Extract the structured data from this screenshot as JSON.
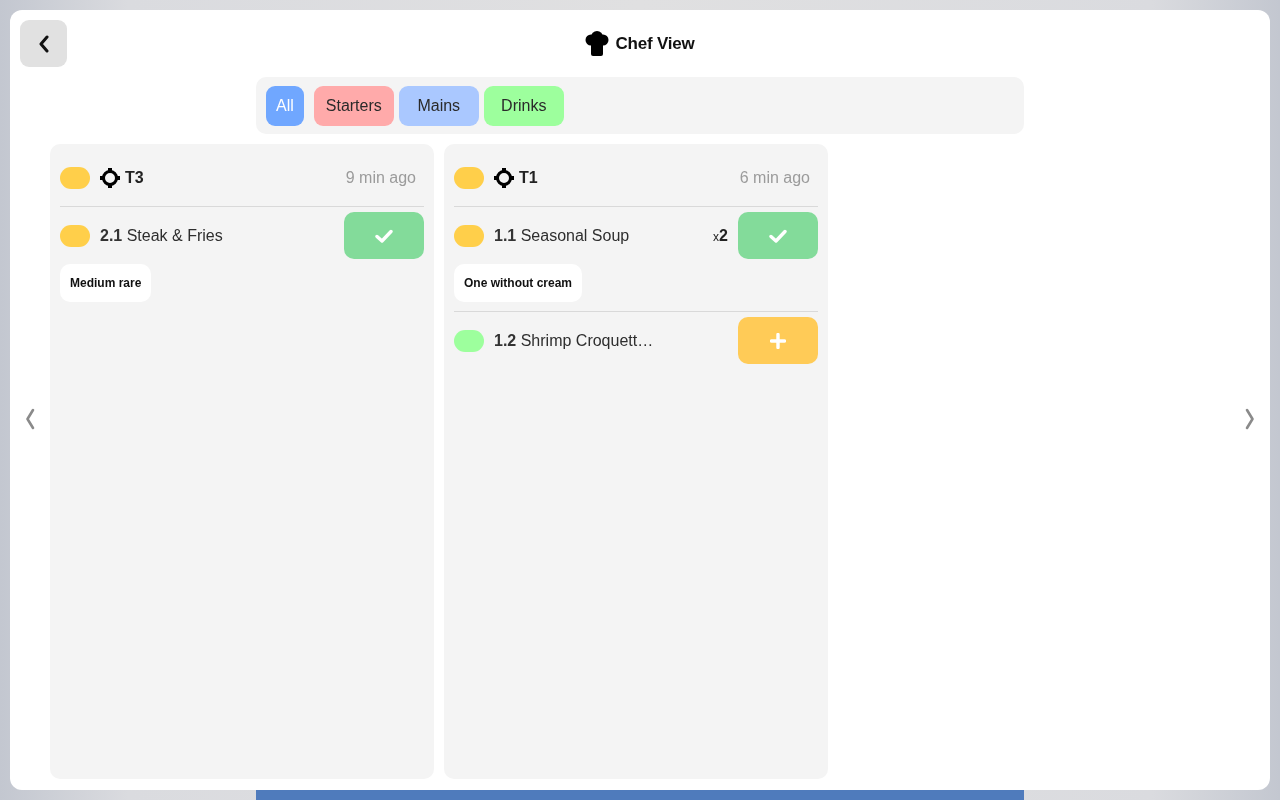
{
  "header": {
    "title": "Chef View"
  },
  "filters": [
    {
      "label": "All",
      "kind": "all",
      "selected": true,
      "color": "#70a7ff"
    },
    {
      "label": "Starters",
      "kind": "category",
      "selected": false,
      "color": "#ffaaaa"
    },
    {
      "label": "Mains",
      "kind": "category",
      "selected": false,
      "color": "#aac8ff"
    },
    {
      "label": "Drinks",
      "kind": "category",
      "selected": false,
      "color": "#9dff9d"
    }
  ],
  "orders": [
    {
      "table": "T3",
      "time": "9 min ago",
      "color": "#ffcf4a",
      "items": [
        {
          "label": "**2.1** Steak & Fries",
          "color": "#ffcf4a",
          "kind": "ready",
          "note": "Medium rare"
        }
      ]
    },
    {
      "table": "T1",
      "time": "6 min ago",
      "color": "#ffcf4a",
      "items": [
        {
          "label": "**1.1** Seasonal Soup",
          "quantity": "x**2**",
          "color": "#ffcf4a",
          "kind": "ready",
          "note": "One without cream"
        },
        {
          "label": "**1.2** Shrimp Croquett…",
          "color": "#9dff9d",
          "kind": "pending"
        }
      ]
    }
  ]
}
